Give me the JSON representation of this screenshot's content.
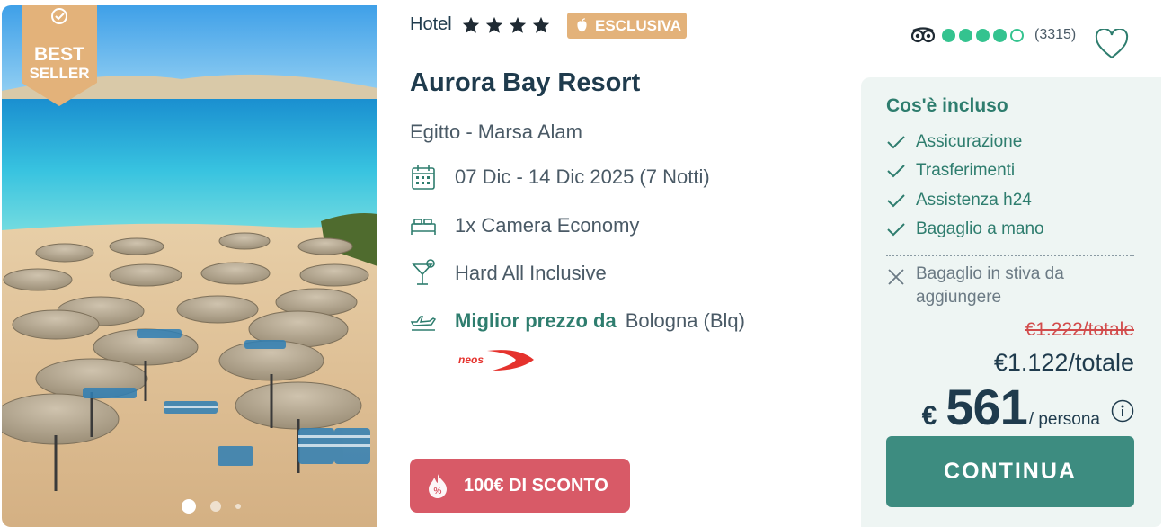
{
  "photo": {
    "alt_icon": "beach-resort-photo",
    "ribbon": {
      "line1": "BEST",
      "line2": "SELLER",
      "color": "#e3b27a"
    },
    "carousel": {
      "count": 3,
      "active": 0
    }
  },
  "hotel": {
    "category_label": "Hotel",
    "stars": 4,
    "badge_label": "ESCLUSIVA",
    "badge_color": "#e3b27a",
    "name": "Aurora Bay Resort",
    "location": "Egitto - Marsa Alam"
  },
  "details": {
    "dates": "07 Dic - 14 Dic 2025 (7 Notti)",
    "room": "1x Camera Economy",
    "board": "Hard All Inclusive",
    "best_price_label": "Miglior prezzo da",
    "departure": "Bologna (Blq)",
    "airline_logo_text": "neos"
  },
  "discount": {
    "label": "100€ DI SCONTO",
    "color": "#d85a67"
  },
  "rating": {
    "icon": "tripadvisor-icon",
    "score": 4,
    "max": 5,
    "count": "(3315)",
    "color": "#34c38f"
  },
  "included": {
    "title": "Cos'è incluso",
    "items": [
      "Assicurazione",
      "Trasferimenti",
      "Assistenza h24",
      "Bagaglio a mano"
    ],
    "excluded": [
      "Bagaglio in stiva da aggiungere"
    ]
  },
  "price": {
    "old_total": "€1.222/totale",
    "total": "€1.122/totale",
    "currency": "€",
    "per_person": "561",
    "per_person_unit": "/ persona"
  },
  "actions": {
    "continue_label": "CONTINUA",
    "continue_color": "#3d8c80"
  }
}
